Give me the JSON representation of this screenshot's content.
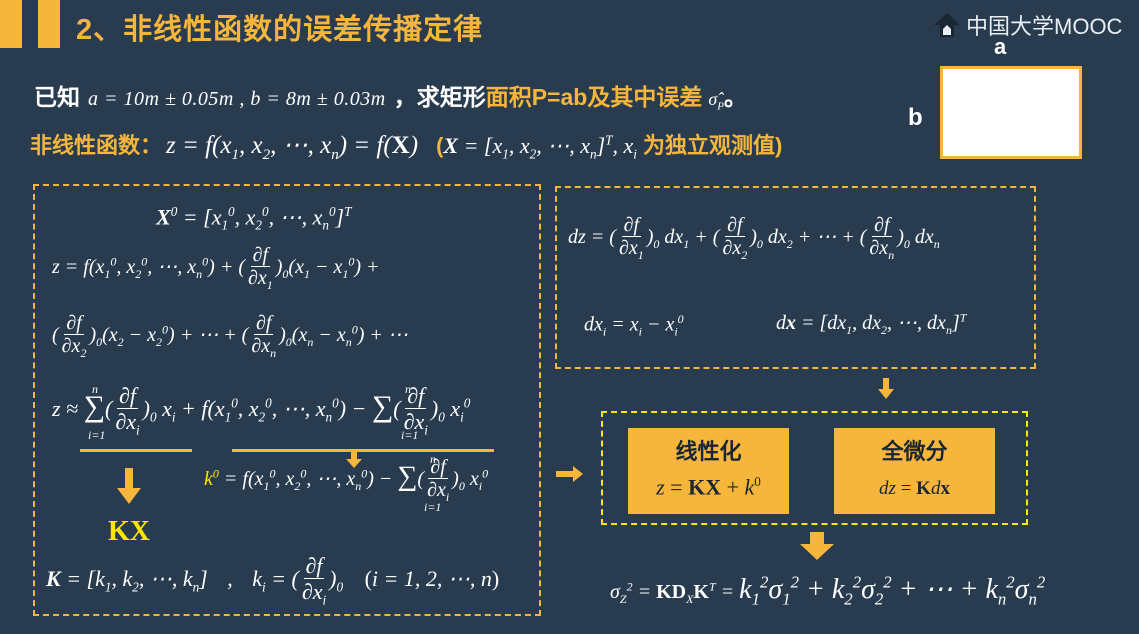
{
  "header": {
    "title": "2、非线性函数的误差传播定律",
    "logo_text": "中国大学MOOC"
  },
  "given": {
    "prefix": "已知",
    "expression": "a = 10m ± 0.05m , b = 8m ± 0.03m",
    "middle": "，求矩形",
    "highlight": "面积P=ab及其中误差",
    "sigma": "σ̂",
    "sigma_sub": "P",
    "end": "。"
  },
  "nonlinear": {
    "label": "非线性函数：",
    "parenthetical": "为独立观测值)"
  },
  "figure": {
    "label_a": "a",
    "label_b": "b"
  },
  "left_box": {
    "kx_label": "KX"
  },
  "mid_box": {
    "linear_title": "线性化",
    "total_diff_title": "全微分"
  }
}
